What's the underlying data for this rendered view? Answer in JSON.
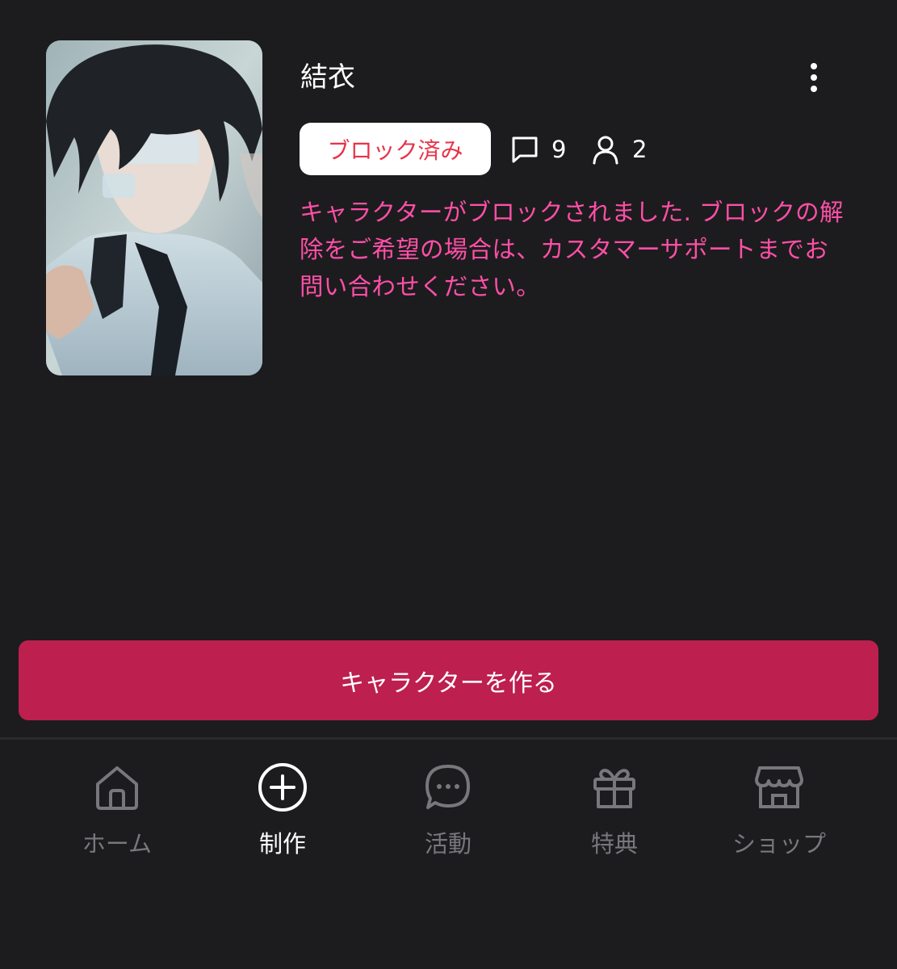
{
  "profile": {
    "name": "結衣",
    "status_badge": "ブロック済み",
    "chat_count": "9",
    "user_count": "2",
    "notice": "キャラクターがブロックされました. ブロックの解除をご希望の場合は、カスタマーサポートまでお問い合わせください。"
  },
  "actions": {
    "create_label": "キャラクターを作る"
  },
  "tabbar": {
    "items": [
      {
        "label": "ホーム",
        "icon": "home-icon"
      },
      {
        "label": "制作",
        "icon": "plus-circle-icon"
      },
      {
        "label": "活動",
        "icon": "chat-bubble-icon"
      },
      {
        "label": "特典",
        "icon": "gift-icon"
      },
      {
        "label": "ショップ",
        "icon": "store-icon"
      }
    ],
    "active_index": 1
  },
  "colors": {
    "background": "#1c1c1e",
    "accent": "#bd1f4f",
    "notice_text": "#ff4fa7",
    "badge_text": "#e8334a",
    "inactive_tab": "#77777c"
  }
}
